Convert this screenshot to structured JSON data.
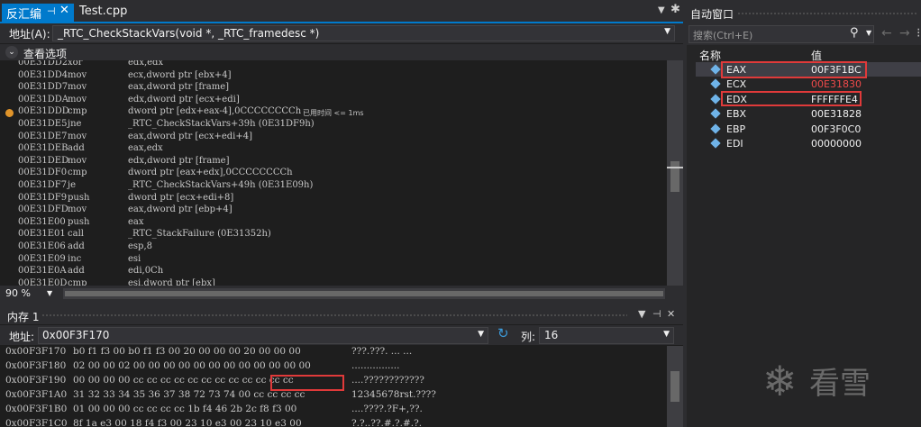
{
  "disassembly": {
    "tab_title": "反汇编",
    "pin_glyph": "⊣",
    "close_glyph": "✕",
    "file_tab": "Test.cpp",
    "address_label": "地址(A):",
    "address_value": "_RTC_CheckStackVars(void *, _RTC_framedesc *)",
    "view_options_label": "查看选项",
    "zoom": "90 %",
    "lines": [
      {
        "addr": "00E31DD2",
        "mnem": "xor",
        "ops": "edx,edx"
      },
      {
        "addr": "00E31DD4",
        "mnem": "mov",
        "ops": "ecx,dword ptr [ebx+4]"
      },
      {
        "addr": "00E31DD7",
        "mnem": "mov",
        "ops": "eax,dword ptr [frame]"
      },
      {
        "addr": "00E31DDA",
        "mnem": "mov",
        "ops": "edx,dword ptr [ecx+edi]"
      },
      {
        "addr": "00E31DDD",
        "mnem": "cmp",
        "ops": "dword ptr [edx+eax-4],0CCCCCCCCh",
        "elapsed": "已用时间 <= 1ms",
        "current": true
      },
      {
        "addr": "00E31DE5",
        "mnem": "jne",
        "ops": "_RTC_CheckStackVars+39h (0E31DF9h)"
      },
      {
        "addr": "00E31DE7",
        "mnem": "mov",
        "ops": "eax,dword ptr [ecx+edi+4]"
      },
      {
        "addr": "00E31DEB",
        "mnem": "add",
        "ops": "eax,edx"
      },
      {
        "addr": "00E31DED",
        "mnem": "mov",
        "ops": "edx,dword ptr [frame]"
      },
      {
        "addr": "00E31DF0",
        "mnem": "cmp",
        "ops": "dword ptr [eax+edx],0CCCCCCCCh"
      },
      {
        "addr": "00E31DF7",
        "mnem": "je",
        "ops": "_RTC_CheckStackVars+49h (0E31E09h)"
      },
      {
        "addr": "00E31DF9",
        "mnem": "push",
        "ops": "dword ptr [ecx+edi+8]"
      },
      {
        "addr": "00E31DFD",
        "mnem": "mov",
        "ops": "eax,dword ptr [ebp+4]"
      },
      {
        "addr": "00E31E00",
        "mnem": "push",
        "ops": "eax"
      },
      {
        "addr": "00E31E01",
        "mnem": "call",
        "ops": "_RTC_StackFailure (0E31352h)"
      },
      {
        "addr": "00E31E06",
        "mnem": "add",
        "ops": "esp,8"
      },
      {
        "addr": "00E31E09",
        "mnem": "inc",
        "ops": "esi"
      },
      {
        "addr": "00E31E0A",
        "mnem": "add",
        "ops": "edi,0Ch"
      },
      {
        "addr": "00E31E0D",
        "mnem": "cmp",
        "ops": "esi,dword ptr [ebx]"
      }
    ]
  },
  "memory": {
    "title": "内存 1",
    "address_label": "地址:",
    "address_value": "0x00F3F170",
    "columns_label": "列:",
    "columns_value": "16",
    "rows": [
      {
        "addr": "0x00F3F170",
        "hex": "b0 f1 f3 00 b0 f1 f3 00 20 00 00 00 20 00 00 00",
        "ascii": "???.???. ... ..."
      },
      {
        "addr": "0x00F3F180",
        "hex": "02 00 00 02 00 00 00 00 00 00 00 00 00 00 00 00",
        "ascii": "................"
      },
      {
        "addr": "0x00F3F190",
        "hex": "00 00 00 00 cc cc cc cc cc cc cc cc cc cc cc cc",
        "ascii": "....????????????"
      },
      {
        "addr": "0x00F3F1A0",
        "hex": "31 32 33 34 35 36 37 38 72 73 74 00 cc cc cc cc",
        "ascii": "12345678rst.????"
      },
      {
        "addr": "0x00F3F1B0",
        "hex": "01 00 00 00 cc cc cc cc 1b f4 46 2b 2c f8 f3 00",
        "ascii": "....????.?F+,??."
      },
      {
        "addr": "0x00F3F1C0",
        "hex": "8f 1a e3 00 18 f4 f3 00 23 10 e3 00 23 10 e3 00",
        "ascii": "?.?..??.#.?.#.?."
      }
    ]
  },
  "autos": {
    "title": "自动窗口",
    "search_placeholder": "搜索(Ctrl+E)",
    "col_name": "名称",
    "col_value": "值",
    "rows": [
      {
        "name": "EAX",
        "value": "00F3F1BC",
        "changed": false,
        "selected": true
      },
      {
        "name": "ECX",
        "value": "00E31830",
        "changed": true,
        "selected": false
      },
      {
        "name": "EDX",
        "value": "FFFFFFE4",
        "changed": false,
        "selected": false
      },
      {
        "name": "EBX",
        "value": "00E31828",
        "changed": false,
        "selected": false
      },
      {
        "name": "EBP",
        "value": "00F3F0C0",
        "changed": false,
        "selected": false
      },
      {
        "name": "EDI",
        "value": "00000000",
        "changed": false,
        "selected": false
      }
    ]
  },
  "watermark": {
    "icon": "snowflake-icon",
    "text": "看雪"
  },
  "colors": {
    "accent": "#007acc",
    "highlight": "#e03a3a",
    "changed_value": "#f04a4a"
  }
}
